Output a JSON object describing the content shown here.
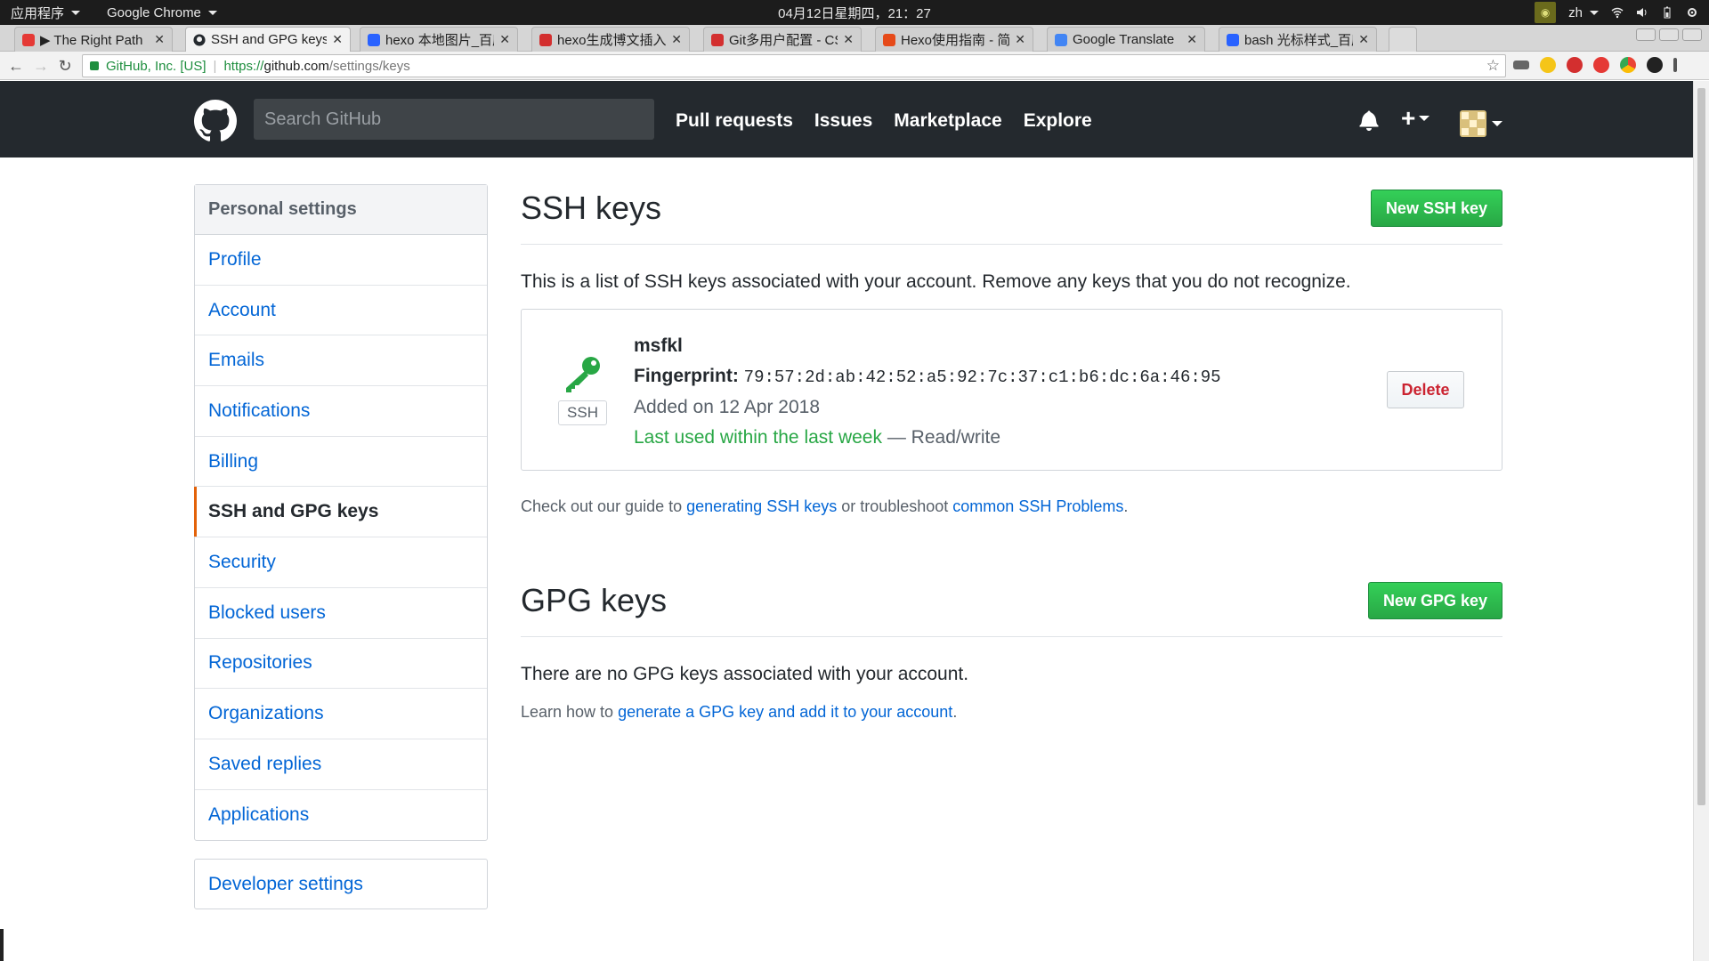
{
  "os": {
    "apps_menu": "应用程序",
    "active_app": "Google Chrome",
    "clock": "04月12日星期四，21：27",
    "lang": "zh"
  },
  "tabs": [
    {
      "title": "▶ The Right Path",
      "favicon_color": "#e53935",
      "active": false
    },
    {
      "title": "SSH and GPG keys",
      "favicon_color": "#24292e",
      "active": true
    },
    {
      "title": "hexo 本地图片_百度",
      "favicon_color": "#2962ff",
      "active": false
    },
    {
      "title": "hexo生成博文插入图",
      "favicon_color": "#d32f2f",
      "active": false
    },
    {
      "title": "Git多用户配置 - CSDN",
      "favicon_color": "#d32f2f",
      "active": false
    },
    {
      "title": "Hexo使用指南 - 简书",
      "favicon_color": "#e64a19",
      "active": false
    },
    {
      "title": "Google Translate",
      "favicon_color": "#4285f4",
      "active": false
    },
    {
      "title": "bash 光标样式_百度",
      "favicon_color": "#2962ff",
      "active": false
    }
  ],
  "address": {
    "origin_label": "GitHub, Inc. [US]",
    "scheme": "https://",
    "host": "github.com",
    "path": "/settings/keys"
  },
  "header": {
    "search_placeholder": "Search GitHub",
    "nav": [
      "Pull requests",
      "Issues",
      "Marketplace",
      "Explore"
    ],
    "plus": "+"
  },
  "sidebar": {
    "heading": "Personal settings",
    "items": [
      {
        "label": "Profile"
      },
      {
        "label": "Account"
      },
      {
        "label": "Emails"
      },
      {
        "label": "Notifications"
      },
      {
        "label": "Billing"
      },
      {
        "label": "SSH and GPG keys",
        "selected": true
      },
      {
        "label": "Security"
      },
      {
        "label": "Blocked users"
      },
      {
        "label": "Repositories"
      },
      {
        "label": "Organizations"
      },
      {
        "label": "Saved replies"
      },
      {
        "label": "Applications"
      }
    ],
    "developer": "Developer settings"
  },
  "ssh": {
    "title": "SSH keys",
    "new_button": "New SSH key",
    "description": "This is a list of SSH keys associated with your account. Remove any keys that you do not recognize.",
    "key": {
      "name": "msfkl",
      "fingerprint_label": "Fingerprint:",
      "fingerprint": "79:57:2d:ab:42:52:a5:92:7c:37:c1:b6:dc:6a:46:95",
      "added": "Added on 12 Apr 2018",
      "last_used": "Last used within the last week",
      "access": "— Read/write",
      "type_label": "SSH",
      "delete_button": "Delete"
    },
    "guide_prefix": "Check out our guide to ",
    "guide_link1": "generating SSH keys",
    "guide_mid": " or troubleshoot ",
    "guide_link2": "common SSH Problems",
    "guide_suffix": "."
  },
  "gpg": {
    "title": "GPG keys",
    "new_button": "New GPG key",
    "empty": "There are no GPG keys associated with your account.",
    "learn_prefix": "Learn how to ",
    "learn_link": "generate a GPG key and add it to your account",
    "learn_suffix": "."
  },
  "colors": {
    "header_bg": "#24292e",
    "link": "#0366d6",
    "green": "#28a745",
    "danger": "#cb2431",
    "selected_marker": "#e36209"
  }
}
